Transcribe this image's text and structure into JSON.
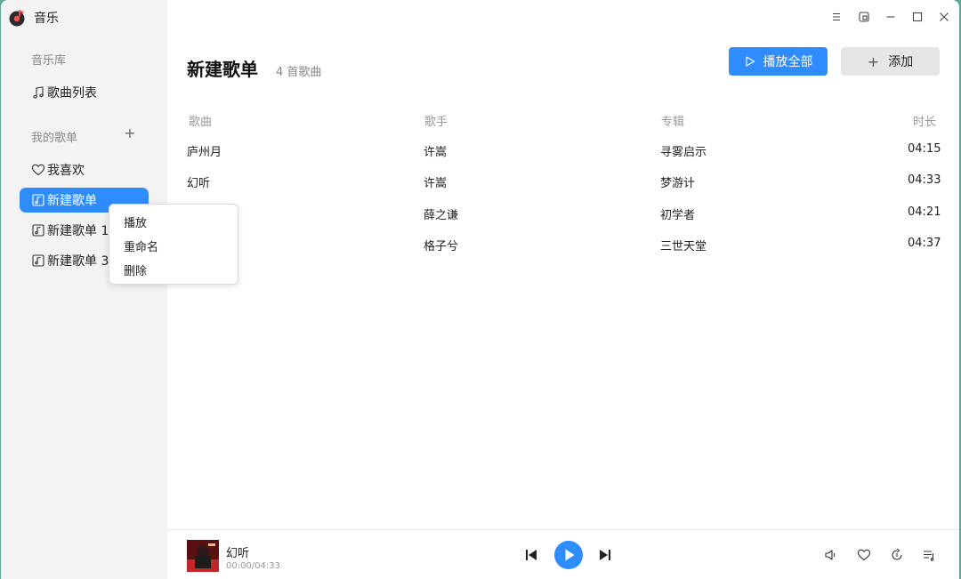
{
  "app": {
    "name": "音乐",
    "logo": "music-app-logo"
  },
  "sidebar": {
    "library_label": "音乐库",
    "song_list": {
      "label": "歌曲列表",
      "icon": "music-note-icon"
    },
    "my_playlists_label": "我的歌单",
    "add_playlist_icon": "plus-icon",
    "add_playlist_glyph": "+",
    "playlists": [
      {
        "label": "我喜欢",
        "icon": "heart-icon"
      },
      {
        "label": "新建歌单",
        "icon": "playlist-icon",
        "active": true
      },
      {
        "label": "新建歌单 1",
        "icon": "playlist-icon"
      },
      {
        "label": "新建歌单 3",
        "icon": "playlist-icon"
      }
    ]
  },
  "context_menu": {
    "items": [
      "播放",
      "重命名",
      "删除"
    ]
  },
  "titlebar": {
    "icons": [
      "menu-icon",
      "mini-mode-icon",
      "minimize-icon",
      "maximize-icon",
      "close-icon"
    ]
  },
  "header": {
    "title": "新建歌单",
    "count": "4 首歌曲",
    "play_all": "播放全部",
    "add": "添加",
    "add_glyph": "+"
  },
  "table": {
    "columns": [
      "歌曲",
      "歌手",
      "专辑",
      "时长"
    ],
    "rows": [
      {
        "song": "庐州月",
        "artist": "许嵩",
        "album": "寻雾启示",
        "duration": "04:15"
      },
      {
        "song": "幻听",
        "artist": "许嵩",
        "album": "梦游计",
        "duration": "04:33"
      },
      {
        "song": "",
        "artist": "薛之谦",
        "album": "初学者",
        "duration": "04:21"
      },
      {
        "song": "",
        "artist": "格子兮",
        "album": "三世天堂",
        "duration": "04:37"
      }
    ]
  },
  "player": {
    "title": "幻听",
    "time": "00:00/04:33",
    "progress": 0,
    "icons": [
      "prev-icon",
      "play-icon",
      "next-icon",
      "volume-icon",
      "favorite-icon",
      "play-mode-icon",
      "queue-icon"
    ]
  },
  "colors": {
    "accent": "#2f8cff",
    "sidebar_bg": "#f3f3f3",
    "desktop_bg": "#5fa89a"
  }
}
